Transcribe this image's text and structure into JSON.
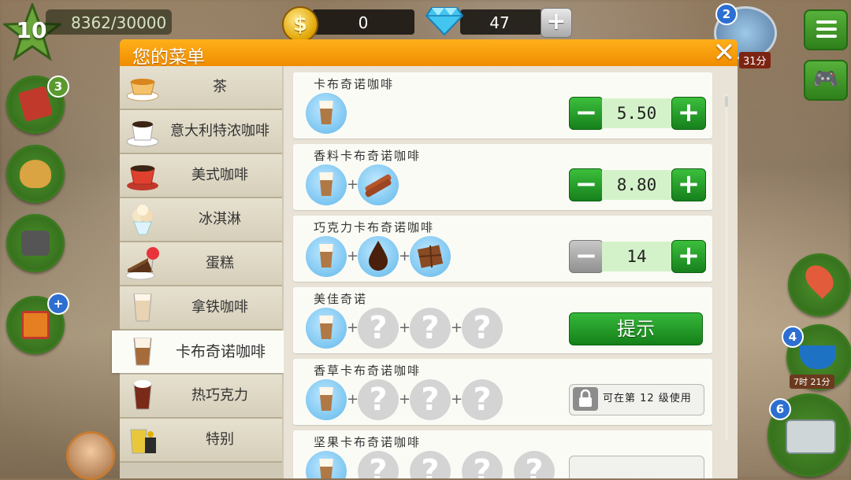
{
  "hud": {
    "level": "10",
    "xp": "8362/30000",
    "coins": "0",
    "gems": "47",
    "gem_add": "+"
  },
  "side": {
    "book_badge": "3",
    "gift_badge": "+",
    "map_badge": "2",
    "map_timer": "31分",
    "coffee_badge": "4",
    "coffee_timer": "7时 21分",
    "register_badge": "6"
  },
  "dialog": {
    "title": "您的菜单",
    "close": "✕"
  },
  "categories": [
    {
      "label": "茶",
      "icon": "tea-cup-icon"
    },
    {
      "label": "意大利特浓咖啡",
      "icon": "espresso-cup-icon"
    },
    {
      "label": "美式咖啡",
      "icon": "americano-cup-icon"
    },
    {
      "label": "冰淇淋",
      "icon": "ice-cream-icon"
    },
    {
      "label": "蛋糕",
      "icon": "cake-icon"
    },
    {
      "label": "拿铁咖啡",
      "icon": "latte-glass-icon"
    },
    {
      "label": "卡布奇诺咖啡",
      "icon": "cappuccino-glass-icon",
      "active": true
    },
    {
      "label": "热巧克力",
      "icon": "hot-chocolate-icon"
    },
    {
      "label": "特别",
      "icon": "special-drink-icon"
    }
  ],
  "recipes": [
    {
      "name": "卡布奇诺咖啡",
      "price": "5.50",
      "ingredients": [
        "cappuccino"
      ]
    },
    {
      "name": "香料卡布奇诺咖啡",
      "price": "8.80",
      "ingredients": [
        "cappuccino",
        "cinnamon"
      ]
    },
    {
      "name": "巧克力卡布奇诺咖啡",
      "price": "14",
      "ingredients": [
        "cappuccino",
        "chocolate-syrup",
        "chocolate-bar"
      ]
    },
    {
      "name": "美佳奇诺",
      "hint": "提示",
      "ingredients": [
        "cappuccino",
        "?",
        "?",
        "?"
      ]
    },
    {
      "name": "香草卡布奇诺咖啡",
      "lock": "可在第 12 级使用",
      "ingredients": [
        "cappuccino",
        "?",
        "?",
        "?"
      ]
    },
    {
      "name": "坚果卡布奇诺咖啡",
      "ingredients": [
        "cappuccino",
        "?",
        "?",
        "?",
        "?"
      ]
    }
  ],
  "symbols": {
    "plus": "+",
    "minus": "−",
    "question": "?"
  },
  "colors": {
    "header": "#f59a0a",
    "green": "#1e9a22",
    "bubble": "#6cc0ee"
  }
}
